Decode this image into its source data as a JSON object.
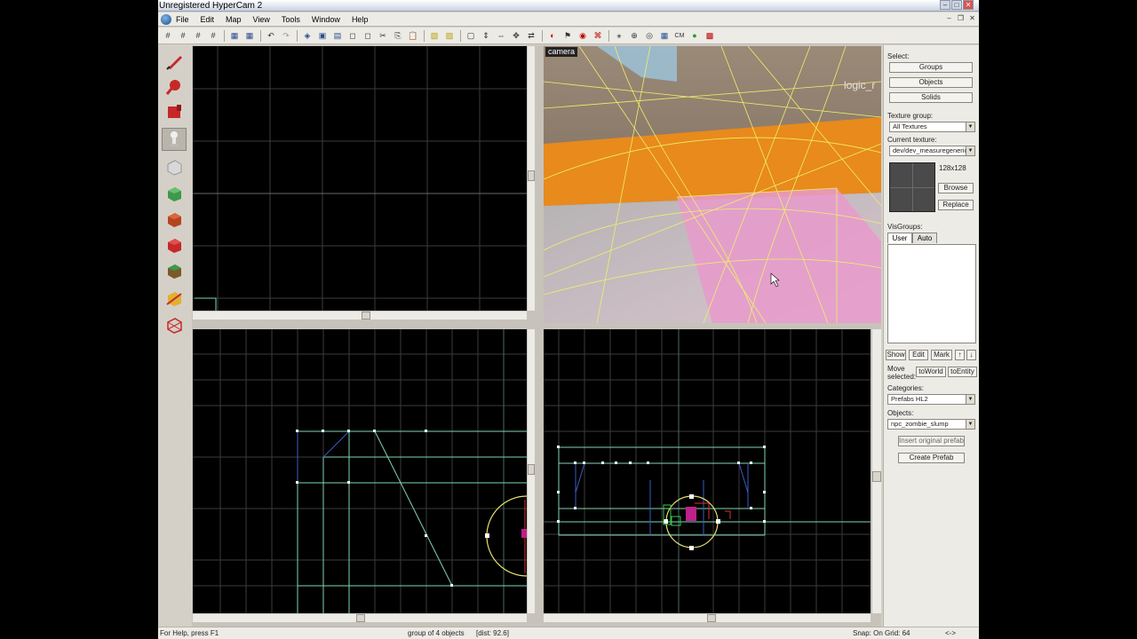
{
  "window": {
    "title": "Unregistered HyperCam 2"
  },
  "menu": {
    "items": [
      "File",
      "Edit",
      "Map",
      "View",
      "Tools",
      "Window",
      "Help"
    ]
  },
  "camera_view": {
    "label": "camera",
    "entity_text": "logic_r"
  },
  "right_panel": {
    "select_label": "Select:",
    "groups_label": "Groups",
    "objects_label": "Objects",
    "solids_label": "Solids",
    "texture_group_label": "Texture group:",
    "texture_group_value": "All Textures",
    "current_texture_label": "Current texture:",
    "current_texture_value": "dev/dev_measuregeneric",
    "texture_size": "128x128",
    "browse_label": "Browse",
    "replace_label": "Replace",
    "visgroups_label": "VisGroups:",
    "tab_user": "User",
    "tab_auto": "Auto",
    "show_label": "Show",
    "edit_label": "Edit",
    "mark_label": "Mark",
    "move_selected_label": "Move selected:",
    "to_world_label": "toWorld",
    "to_entity_label": "toEntity",
    "categories_label": "Categories:",
    "categories_value": "Prefabs HL2",
    "objects_field_label": "Objects:",
    "objects_value": "npc_zombie_slump",
    "insert_prefab_label": "Insert original prefab",
    "create_prefab_label": "Create Prefab"
  },
  "status": {
    "help": "For Help, press F1",
    "selection": "group of 4 objects",
    "dist": "[dist: 92.6]",
    "snap": "Snap: On Grid: 64",
    "extra": "<->"
  },
  "colors": {
    "grid": "#3b3b3b",
    "grid_major": "#4a6b5e",
    "wire_blue": "#3d5cc4",
    "wire_green": "#7fd6b0",
    "selection_yellow": "#e8e070",
    "entity_magenta": "#c0208a"
  }
}
